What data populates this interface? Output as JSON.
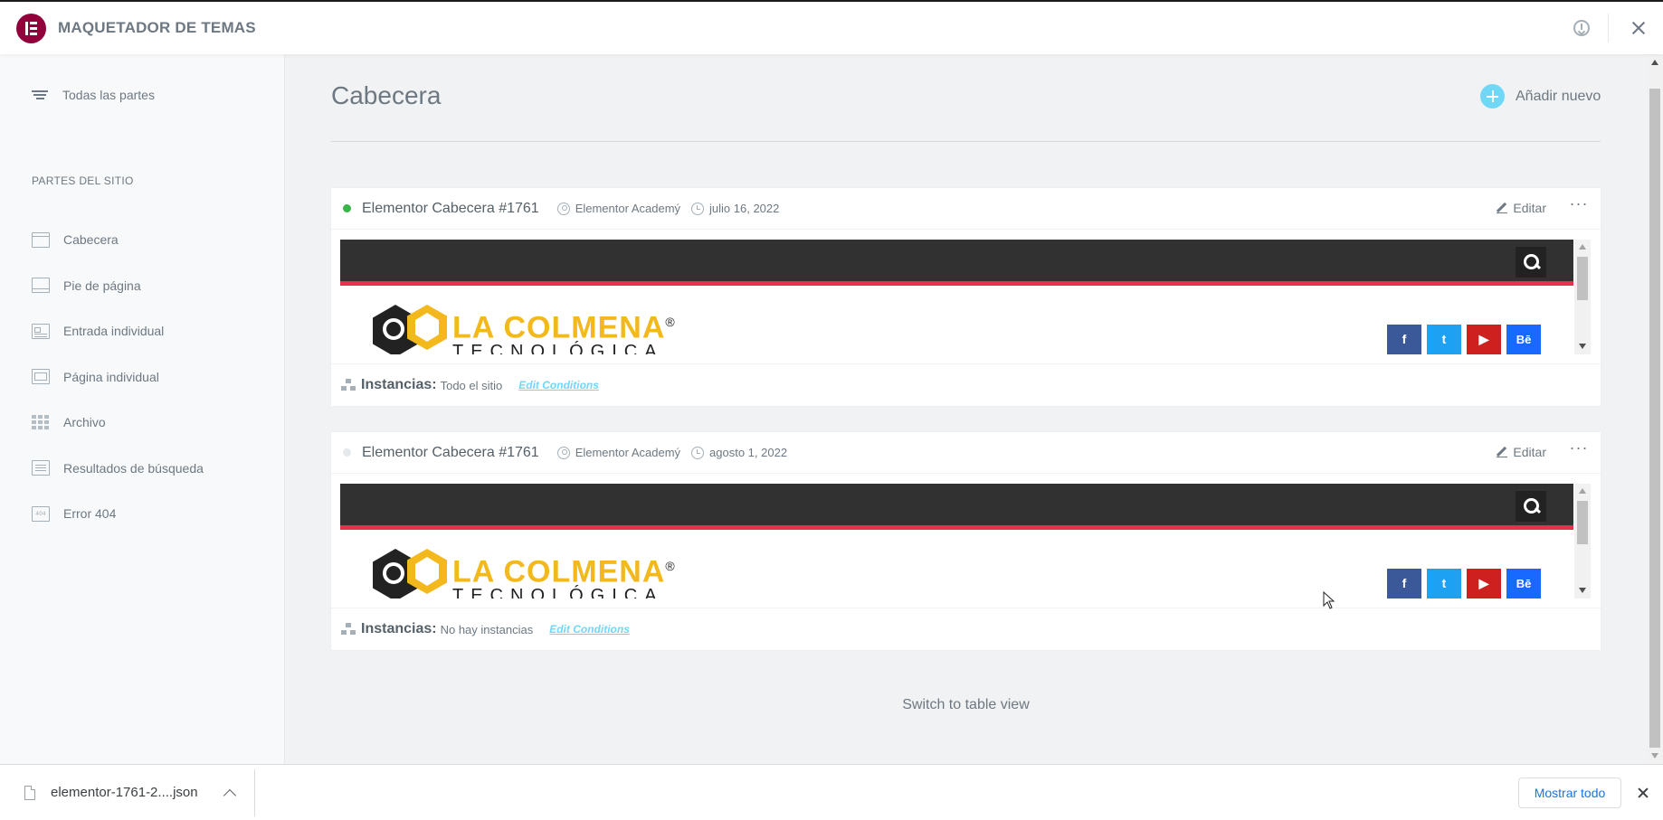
{
  "app": {
    "title": "MAQUETADOR DE TEMAS"
  },
  "sidebar": {
    "all_parts": "Todas las partes",
    "heading": "PARTES DEL SITIO",
    "items": [
      {
        "label": "Cabecera",
        "icon": "header-icon"
      },
      {
        "label": "Pie de página",
        "icon": "footer-icon"
      },
      {
        "label": "Entrada individual",
        "icon": "single-post-icon"
      },
      {
        "label": "Página individual",
        "icon": "single-page-icon"
      },
      {
        "label": "Archivo",
        "icon": "archive-icon"
      },
      {
        "label": "Resultados de búsqueda",
        "icon": "search-results-icon"
      },
      {
        "label": "Error 404",
        "icon": "error-404-icon"
      }
    ]
  },
  "main": {
    "title": "Cabecera",
    "add_new": "Añadir nuevo",
    "cards": [
      {
        "title": "Elementor Cabecera #1761",
        "status": "active",
        "status_color": "#39b54a",
        "author": "Elementor Academý",
        "date": "julio 16, 2022",
        "edit": "Editar",
        "instances_label": "Instancias:",
        "instances_value": "Todo el sitio",
        "edit_conditions": "Edit Conditions",
        "preview": {
          "brand_line1": "LA COLMENA",
          "brand_reg": "®",
          "brand_line2": "TECNOLÓGICA",
          "social": [
            "f",
            "t",
            "▶",
            "Bē"
          ]
        }
      },
      {
        "title": "Elementor Cabecera #1761",
        "status": "inactive",
        "status_color": "#e6e9ec",
        "author": "Elementor Academý",
        "date": "agosto 1, 2022",
        "edit": "Editar",
        "instances_label": "Instancias:",
        "instances_value": "No hay instancias",
        "edit_conditions": "Edit Conditions",
        "preview": {
          "brand_line1": "LA COLMENA",
          "brand_reg": "®",
          "brand_line2": "TECNOLÓGICA",
          "social": [
            "f",
            "t",
            "▶",
            "Bē"
          ]
        }
      }
    ],
    "switch_view": "Switch to table view"
  },
  "download_bar": {
    "file_name": "elementor-1761-2....json",
    "show_all": "Mostrar todo"
  },
  "colors": {
    "brand": "#92003b",
    "accent": "#71d7f7",
    "preview_red": "#e4314d",
    "preview_dark": "#313132",
    "brand_yellow": "#f3b81b"
  }
}
